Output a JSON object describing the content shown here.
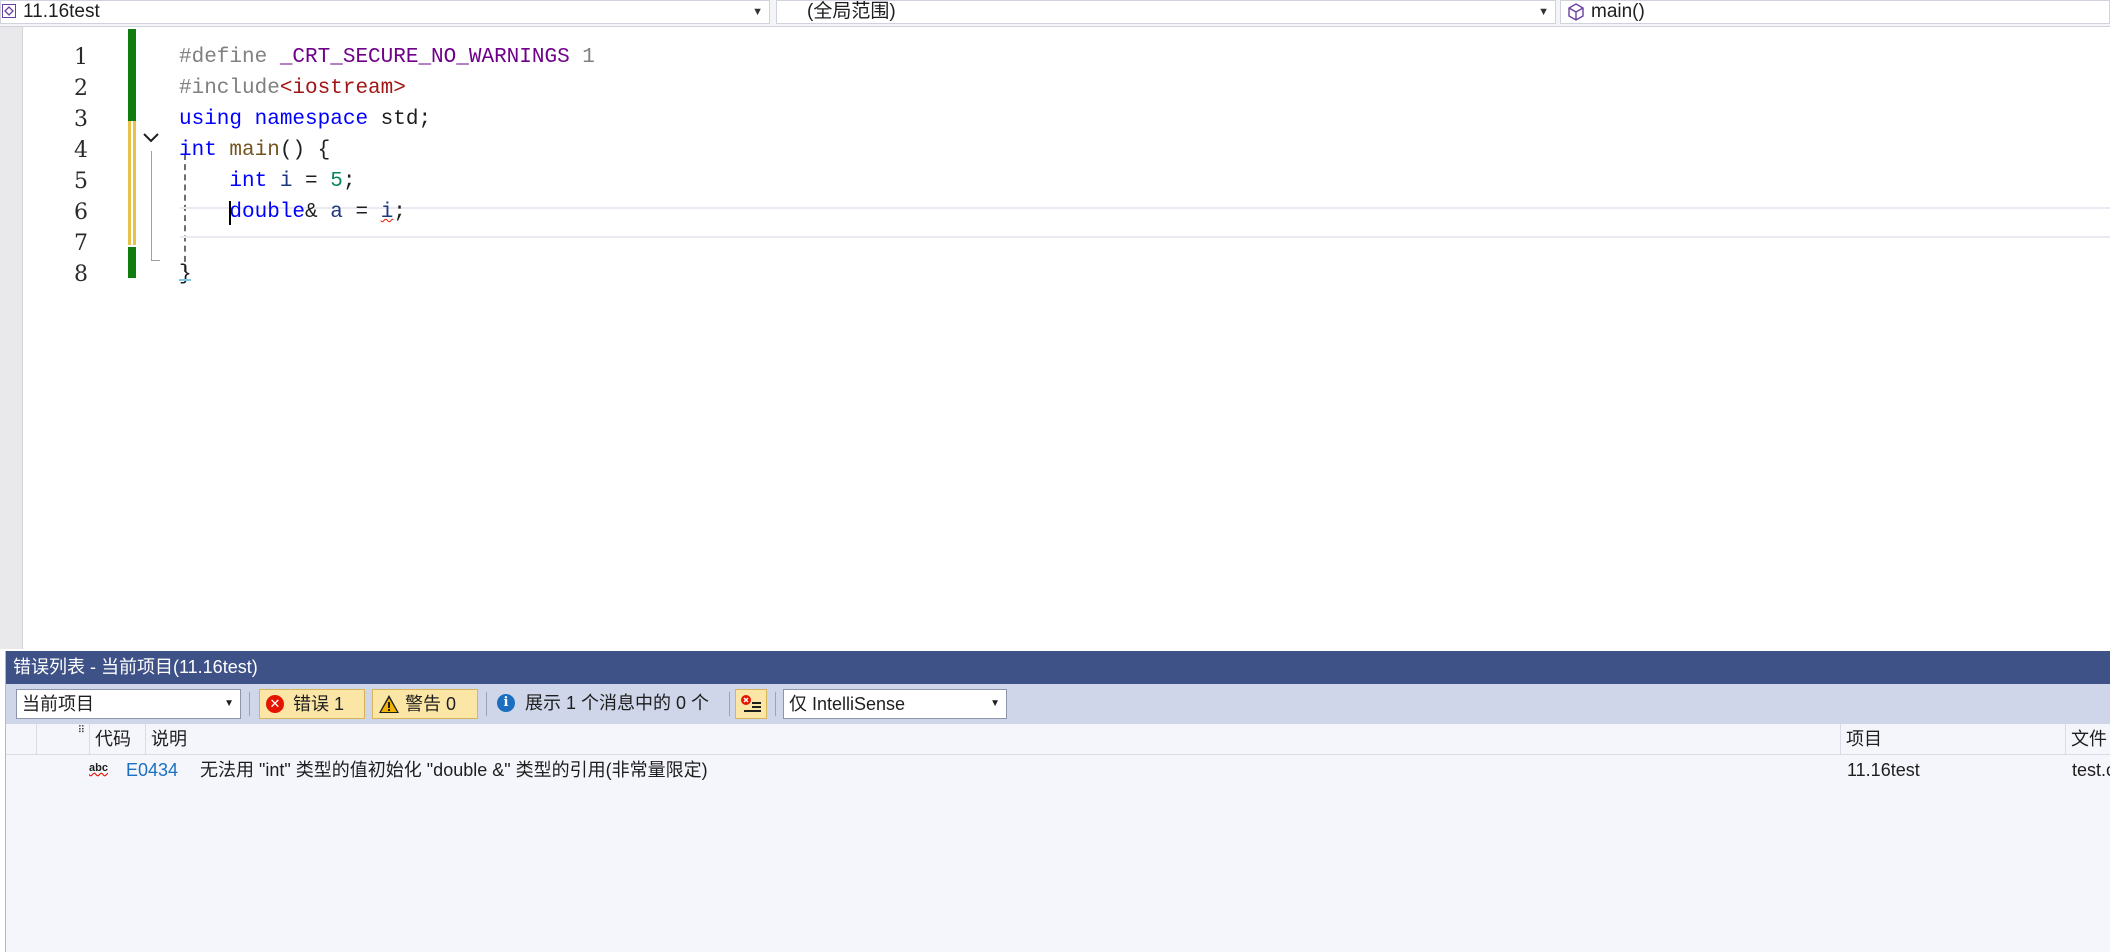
{
  "navigation": {
    "project_dropdown": "11.16test",
    "scope_dropdown": "(全局范围)",
    "member_dropdown": "main()"
  },
  "editor": {
    "line_numbers": [
      "1",
      "2",
      "3",
      "4",
      "5",
      "6",
      "7",
      "8"
    ],
    "lines": [
      {
        "t1": "#define ",
        "t2": "_CRT_SECURE_NO_WARNINGS",
        "t3": " 1"
      },
      {
        "t1": "#include",
        "t2": "<iostream>"
      },
      {
        "t1": "using",
        "t2": " ",
        "t3": "namespace",
        "t4": " std;"
      },
      {
        "t1": "int",
        "t2": " ",
        "t3": "main",
        "t4": "() {"
      },
      {
        "t1": "    ",
        "t2": "int",
        "t3": " ",
        "t4": "i",
        "t5": " = ",
        "t6": "5",
        "t7": ";"
      },
      {
        "t1": "    ",
        "t2": "double",
        "t3": "& ",
        "t4": "a",
        "t5": " = ",
        "t6": "i",
        "t7": ";"
      },
      {
        "t1": ""
      },
      {
        "t1": "}"
      }
    ]
  },
  "error_list": {
    "title": "错误列表 - 当前项目(11.16test)",
    "scope_select": "当前项目",
    "errors_button": "错误 1",
    "warnings_button": "警告 0",
    "messages_button": "展示 1 个消息中的 0 个",
    "source_select": "仅 IntelliSense",
    "columns": {
      "code": "代码",
      "description": "说明",
      "project": "项目",
      "file": "文件"
    },
    "rows": [
      {
        "icon": "abc",
        "code": "E0434",
        "description": "无法用 \"int\" 类型的值初始化 \"double &\" 类型的引用(非常量限定)",
        "project": "11.16test",
        "file": "test.c"
      }
    ]
  },
  "colors": {
    "panel_title": "#3e5288",
    "toolbar": "#cfd6ea",
    "error_code_link": "#1a6fc0",
    "change_saved": "#107c10",
    "change_unsaved": "#e8c14b"
  }
}
